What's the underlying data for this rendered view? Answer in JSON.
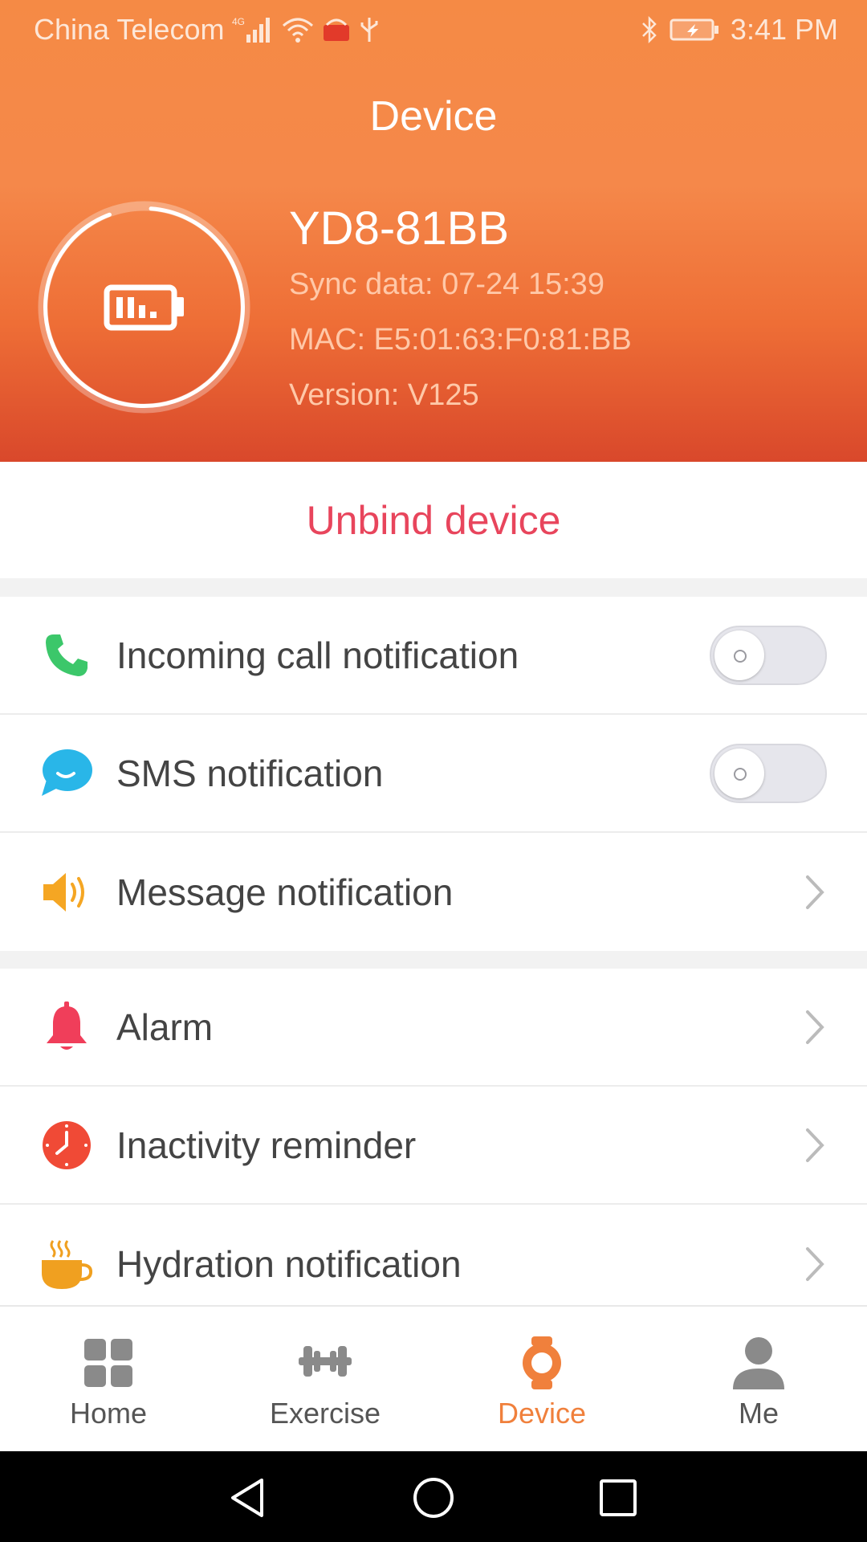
{
  "status_bar": {
    "carrier": "China Telecom",
    "network": "4G",
    "time": "3:41 PM"
  },
  "header": {
    "title": "Device",
    "device_name": "YD8-81BB",
    "sync": "Sync data: 07-24 15:39",
    "mac": "MAC: E5:01:63:F0:81:BB",
    "version": "Version: V125"
  },
  "unbind_label": "Unbind device",
  "notifications": [
    {
      "label": "Incoming call notification",
      "icon": "phone-icon",
      "control": "toggle",
      "on": false
    },
    {
      "label": "SMS notification",
      "icon": "chat-bubble-icon",
      "control": "toggle",
      "on": false
    },
    {
      "label": "Message notification",
      "icon": "speaker-icon",
      "control": "chevron"
    }
  ],
  "reminders": [
    {
      "label": "Alarm",
      "icon": "bell-icon",
      "control": "chevron"
    },
    {
      "label": "Inactivity reminder",
      "icon": "clock-icon",
      "control": "chevron"
    },
    {
      "label": "Hydration notification",
      "icon": "coffee-cup-icon",
      "control": "chevron"
    }
  ],
  "bottom_nav": [
    {
      "label": "Home",
      "icon": "grid-icon",
      "active": false
    },
    {
      "label": "Exercise",
      "icon": "dumbbell-icon",
      "active": false
    },
    {
      "label": "Device",
      "icon": "watch-icon",
      "active": true
    },
    {
      "label": "Me",
      "icon": "person-icon",
      "active": false
    }
  ],
  "colors": {
    "accent": "#f0803c",
    "danger": "#e8455c",
    "header_top": "#f58a45",
    "header_bottom": "#d9482b"
  }
}
